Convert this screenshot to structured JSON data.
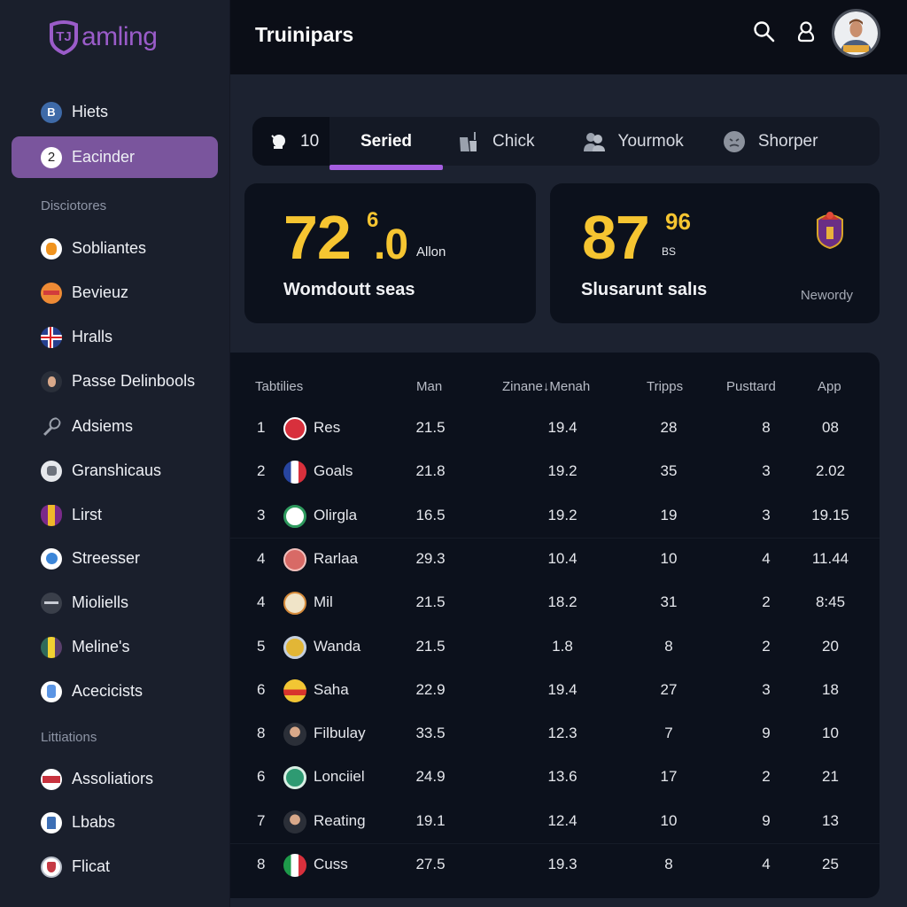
{
  "app": {
    "logo_text": "amling",
    "brand_color": "#9a5cc9",
    "accent_color": "#a55ee0",
    "highlight_color": "#f6c531"
  },
  "sidebar": {
    "items": [
      {
        "label": "Hiets",
        "icon": "b-circle-icon",
        "glyph": "B"
      },
      {
        "label": "Eacinder",
        "icon": "number-2-icon",
        "glyph": "2",
        "active": true
      }
    ],
    "section1": "Disciotores",
    "section1_items": [
      {
        "label": "Sobliantes",
        "icon": "orange-crest-icon"
      },
      {
        "label": "Bevieuz",
        "icon": "orange-badge-icon"
      },
      {
        "label": "Hralls",
        "icon": "cross-flag-icon"
      },
      {
        "label": "Passe Delinbools",
        "icon": "person-avatar-icon"
      },
      {
        "label": "Adsiems",
        "icon": "racket-icon"
      },
      {
        "label": "Granshicaus",
        "icon": "grey-crest-icon"
      },
      {
        "label": "Lirst",
        "icon": "purple-shield-icon"
      },
      {
        "label": "Streesser",
        "icon": "blue-circle-icon"
      },
      {
        "label": "Mioliells",
        "icon": "dark-circle-icon"
      },
      {
        "label": "Meline's",
        "icon": "striped-crest-icon"
      },
      {
        "label": "Acecicists",
        "icon": "blue-bottle-icon"
      }
    ],
    "section2": "Littiations",
    "section2_items": [
      {
        "label": "Assoliatiors",
        "icon": "red-banner-icon"
      },
      {
        "label": "Lbabs",
        "icon": "blue-tower-icon"
      },
      {
        "label": "Flicat",
        "icon": "red-shield-icon"
      }
    ]
  },
  "header": {
    "title": "Truinipars",
    "search_icon": "search-icon",
    "user_icon": "user-icon"
  },
  "tabs": {
    "count": "10",
    "items": [
      {
        "label": "Seried",
        "icon": "",
        "active": true
      },
      {
        "label": "Chick",
        "icon": "chart-icon"
      },
      {
        "label": "Yourmok",
        "icon": "group-icon"
      },
      {
        "label": "Shorper",
        "icon": "face-icon"
      }
    ]
  },
  "cards": [
    {
      "value": "72",
      "sup": "6",
      "decimal": ".0",
      "unit": "Allon",
      "title": "Womdoutt seas"
    },
    {
      "value": "87",
      "sup": "96",
      "unit": "BS",
      "title": "Slusarunt salıs",
      "badge": "Newordy"
    }
  ],
  "table": {
    "headers": [
      "Tabtilies",
      "Man",
      "Zinane↓Menah",
      "Tripps",
      "Pusttard",
      "App"
    ],
    "rows": [
      {
        "rank": "1",
        "team": "Res",
        "man": "21.5",
        "zm": "19.4",
        "tripps": "28",
        "pust": "8",
        "app": "08",
        "icon": "red-crest"
      },
      {
        "rank": "2",
        "team": "Goals",
        "man": "21.8",
        "zm": "19.2",
        "tripps": "35",
        "pust": "3",
        "app": "2.02",
        "icon": "france-flag"
      },
      {
        "rank": "3",
        "team": "Olirgla",
        "man": "16.5",
        "zm": "19.2",
        "tripps": "19",
        "pust": "3",
        "app": "19.15",
        "icon": "green-crest"
      },
      {
        "rank": "4",
        "team": "Rarlaa",
        "man": "29.3",
        "zm": "10.4",
        "tripps": "10",
        "pust": "4",
        "app": "11.44",
        "icon": "pink-crest"
      },
      {
        "rank": "4",
        "team": "Mil",
        "man": "21.5",
        "zm": "18.2",
        "tripps": "31",
        "pust": "2",
        "app": "8:45",
        "icon": "mascot-crest"
      },
      {
        "rank": "5",
        "team": "Wanda",
        "man": "21.5",
        "zm": "1.8",
        "tripps": "8",
        "pust": "2",
        "app": "20",
        "icon": "gold-crest"
      },
      {
        "rank": "6",
        "team": "Saha",
        "man": "22.9",
        "zm": "19.4",
        "tripps": "27",
        "pust": "3",
        "app": "18",
        "icon": "yellow-red-crest"
      },
      {
        "rank": "8",
        "team": "Filbulay",
        "man": "33.5",
        "zm": "12.3",
        "tripps": "7",
        "pust": "9",
        "app": "10",
        "icon": "player-photo"
      },
      {
        "rank": "6",
        "team": "Lonciiel",
        "man": "24.9",
        "zm": "13.6",
        "tripps": "17",
        "pust": "2",
        "app": "21",
        "icon": "green-circle-crest"
      },
      {
        "rank": "7",
        "team": "Reating",
        "man": "19.1",
        "zm": "12.4",
        "tripps": "10",
        "pust": "9",
        "app": "13",
        "icon": "player-photo"
      },
      {
        "rank": "8",
        "team": "Cuss",
        "man": "27.5",
        "zm": "19.3",
        "tripps": "8",
        "pust": "4",
        "app": "25",
        "icon": "italy-flag"
      }
    ]
  }
}
